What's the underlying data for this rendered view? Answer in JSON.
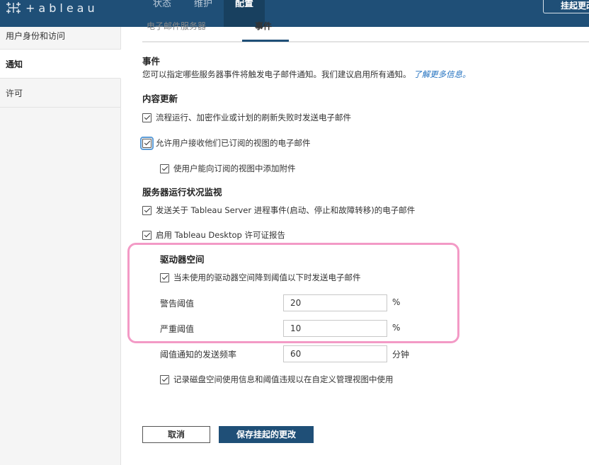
{
  "header": {
    "logo_text": "+ableau",
    "nav": [
      {
        "label": "状态"
      },
      {
        "label": "维护"
      },
      {
        "label": "配置"
      }
    ],
    "pending_button": "挂起更改"
  },
  "sidebar": {
    "items": [
      {
        "label": "用户身份和访问"
      },
      {
        "label": "通知"
      },
      {
        "label": "许可"
      }
    ]
  },
  "tabs": {
    "email_server": "电子邮件服务器",
    "events": "事件"
  },
  "events": {
    "title": "事件",
    "description": "您可以指定哪些服务器事件将触发电子邮件通知。我们建议启用所有通知。",
    "learn_more": "了解更多信息。"
  },
  "content_updates": {
    "title": "内容更新",
    "flow_failure": "流程运行、加密作业或计划的刷新失败时发送电子邮件",
    "allow_subscriptions": "允许用户接收他们已订阅的视图的电子邮件",
    "attachments": "使用户能向订阅的视图中添加附件"
  },
  "server_health": {
    "title": "服务器运行状况监视",
    "process_events": "发送关于 Tableau Server 进程事件(启动、停止和故障转移)的电子邮件",
    "desktop_license": "启用 Tableau Desktop 许可证报告"
  },
  "drive_space": {
    "title": "驱动器空间",
    "below_threshold": "当未使用的驱动器空间降到阈值以下时发送电子邮件",
    "warning_label": "警告阈值",
    "warning_value": "20",
    "warning_unit": "%",
    "critical_label": "严重阈值",
    "critical_value": "10",
    "critical_unit": "%",
    "frequency_label": "阈值通知的发送频率",
    "frequency_value": "60",
    "frequency_unit": "分钟",
    "record_usage": "记录磁盘空间使用信息和阈值违规以在自定义管理视图中使用"
  },
  "actions": {
    "cancel": "取消",
    "save": "保存挂起的更改"
  },
  "colors": {
    "topbar": "#1f4f77",
    "highlight": "#f39ac6",
    "link": "#1f6fbf"
  }
}
